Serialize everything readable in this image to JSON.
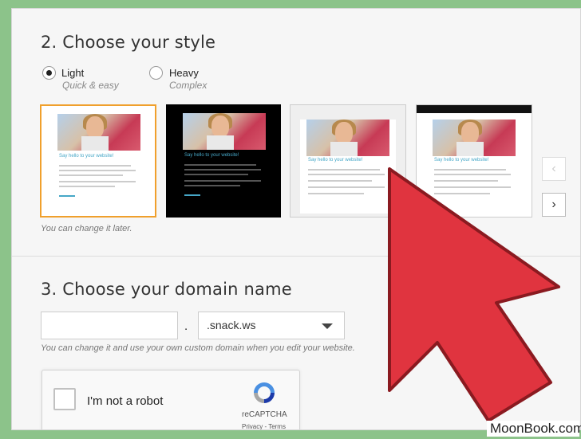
{
  "style_section": {
    "title": "2. Choose your style",
    "options": [
      {
        "label": "Light",
        "sub": "Quick & easy",
        "checked": true
      },
      {
        "label": "Heavy",
        "sub": "Complex",
        "checked": false
      }
    ],
    "thumbnails": [
      {
        "name": "light-theme",
        "heading": "Say hello to your website!"
      },
      {
        "name": "dark-theme",
        "heading": "Say hello to your website!"
      },
      {
        "name": "gray-theme",
        "heading": "Say hello to your website!"
      },
      {
        "name": "banner-theme",
        "heading": "Say hello to your website!"
      }
    ],
    "prev_label": "‹",
    "next_label": "›",
    "hint": "You can change it later."
  },
  "domain_section": {
    "title": "3. Choose your domain name",
    "input_value": "",
    "dot": ".",
    "domain_selected": ".snack.ws",
    "hint": "You can change it and use your own custom domain when you edit your website."
  },
  "captcha": {
    "label": "I'm not a robot",
    "brand": "reCAPTCHA",
    "links": "Privacy - Terms"
  },
  "overlay": {
    "arrow_color": "#e0343f",
    "watermark": "MoonBook.com"
  }
}
